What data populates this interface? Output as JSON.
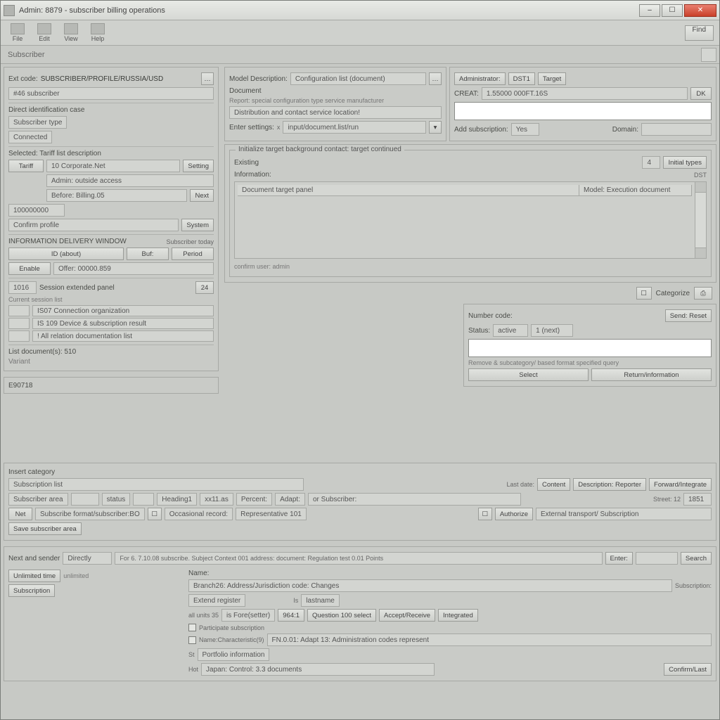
{
  "title": "Admin: 8879 - subscriber billing operations",
  "win": {
    "min": "–",
    "max": "☐",
    "close": "✕"
  },
  "toolbar": {
    "items": [
      "File",
      "Edit",
      "View",
      "Help"
    ],
    "find": "Find"
  },
  "breadcrumb": "Subscriber",
  "header_right_icon": "☰",
  "left": {
    "hdr_label": "Ext code:",
    "hdr_value": "SUBSCRIBER/PROFILE/RUSSIA/USD",
    "sub_value": "#46 subscriber",
    "sep1": "Direct identification case",
    "sep1_sub": "Subscriber type",
    "sep1_sub2": "Connected",
    "group_label": "Selected: Tariff list description",
    "rowA": {
      "l": "Tariff",
      "v": "10 Corporate.Net",
      "b": "Setting"
    },
    "rowB": {
      "l": "",
      "v": "Admin: outside access",
      "b": ""
    },
    "rowC": {
      "l": "",
      "v": "Before: Billing.05",
      "b": "Next"
    },
    "rowD": "100000000",
    "rowE": {
      "l": "Confirm profile",
      "b": "System"
    },
    "rowF_label": "INFORMATION DELIVERY WINDOW",
    "rowF_sub": "Subscriber today",
    "cols": {
      "a": "ID (about)",
      "b": "Buf:",
      "c": "Period"
    },
    "rowG": {
      "l": "Enable",
      "v": "Offer: 00000.859"
    },
    "rowH": {
      "l": "1016",
      "v": "Session extended panel",
      "b": "24"
    },
    "miniHead": "Current session list",
    "list": [
      "IS07  Connection organization",
      "IS  109  Device & subscription result",
      "!  All relation documentation list"
    ],
    "listFooter": {
      "l": "List document(s):  510",
      "r": ""
    },
    "footLabel": "Variant"
  },
  "rtop": {
    "labelA": "Model Description:",
    "labelA_value": "Configuration list (document)",
    "dot_btn": "…",
    "labelB": "Document",
    "labelC": "Report:  special configuration type service manufacturer",
    "labelD_box": "Distribution and contact service location!",
    "labelE_l": "Enter settings:",
    "labelE_sep": "x",
    "labelE_v": "input/document.list/run",
    "labelE_drop": "▾",
    "r_labelA": "Administrator:",
    "r_btnA1": "DST1",
    "r_btnA2": "Target",
    "r_labelB": "CREAT:",
    "r_valueB": "1.55000 000FT.16S",
    "r_btnB": "DK",
    "r_empty": "",
    "r_labelC": "Add subscription:",
    "r_valueC": "Yes",
    "r_labelD": "Domain:"
  },
  "rmid": {
    "gtitle": "Initialize target background contact: target continued",
    "row1_l": "Existing",
    "row1_num": "4",
    "row1_r": "Initial types",
    "row2_l": "Information:",
    "row2_r": "DST",
    "list_hdr_a": "Document target panel",
    "list_hdr_b": "Model: Execution document",
    "footer": "confirm user:  admin"
  },
  "rcat": {
    "btn_l": "☐",
    "label": "Categorize",
    "btn_r": "⎙"
  },
  "rbox": {
    "labelA": "Number code:",
    "btnA": "Send: Reset",
    "labelB": "Status:",
    "valB1": "active",
    "valB2": "1 (next)",
    "note": "Remove & subcategory/ based format specified query",
    "btnL": "Select",
    "btnR": "Return/information"
  },
  "mid_left_code": "E90718",
  "lower": {
    "hdr": "Insert category",
    "tab": "Subscription list",
    "r_col_l": "Last date:",
    "r_btn1": "Content",
    "r_btn2": "Description: Reporter",
    "r_btn3": "Forward/Integrate",
    "rowA": [
      "Subscriber area",
      "",
      "status",
      "",
      "Heading1",
      "xx11.as",
      "Percent:",
      "Adapt:",
      "or Subscriber:"
    ],
    "rowB_l": "Net",
    "rowB_v": "Subscribe format/subscriber:BO",
    "rowB_mid": "Occasional record:",
    "rowB_r": "Representative 101",
    "rowC_l": "Street: 12",
    "rowC_v": "1851",
    "rowC_btn1": "Authorize",
    "rowC_r": "External transport/ Subscription",
    "saveBtn": "Save subscriber area"
  },
  "bottom": {
    "colA_l": "Next and sender",
    "colA_v": "Directly",
    "note": "For 6. 7.10.08 subscribe. Subject Context 001 address: document: Regulation test  0.01 Points",
    "note_btn": "Enter:",
    "note_btn2": "Search",
    "tabA": "Unlimited time",
    "tabA_v": "unlimited",
    "tabB": "Subscription",
    "formLabel": "Name:",
    "form1": "Branch26: Address/Jurisdiction code: Changes",
    "form2_l": "Extend register",
    "form2_l_sub": "Subscription:",
    "form2_m1": "Is",
    "form2_m2": "lastname",
    "form3_l": "all units  35",
    "form3_m": "is  Fore(setter)",
    "form3_btn1": "964:1",
    "form3_btn2": "Question 100 select",
    "form3_btn3": "Accept/Receive",
    "form3_btn4": "Integrated",
    "form4_chk": "Participate subscription",
    "form5_chk": "Name:Characteristic(9)",
    "form5_v": "FN.0.01: Adapt 13: Administration codes represent",
    "form6_l": "St",
    "form6_v": "Portfolio information",
    "form7_l": "Hot",
    "form7_v": "Japan: Control: 3.3 documents",
    "footer_btn": "Confirm/Last"
  }
}
